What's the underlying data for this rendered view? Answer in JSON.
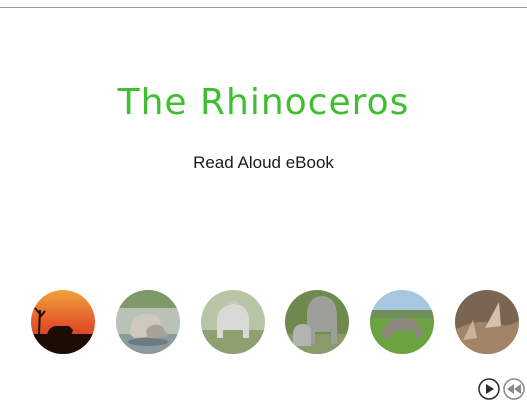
{
  "book": {
    "title": "The Rhinoceros",
    "subtitle": "Read Aloud eBook"
  },
  "colors": {
    "title": "#3fbf2f",
    "subtitle": "#1a1a1a",
    "divider": "#9a9a9a"
  },
  "photos": [
    {
      "name": "rhino-sunset-photo",
      "scene": "rhino silhouette at sunset"
    },
    {
      "name": "rhinos-at-waterhole-photo",
      "scene": "rhinos drinking at a waterhole"
    },
    {
      "name": "white-rhino-photo",
      "scene": "white rhino standing in grass"
    },
    {
      "name": "mother-and-calf-photo",
      "scene": "rhino mother and calf"
    },
    {
      "name": "grazing-rhino-photo",
      "scene": "rhino grazing in a green field"
    },
    {
      "name": "rhino-horns-closeup-photo",
      "scene": "rhino horns close-up"
    }
  ],
  "navigation": {
    "play_icon": "play-icon",
    "rewind_icon": "rewind-icon"
  }
}
